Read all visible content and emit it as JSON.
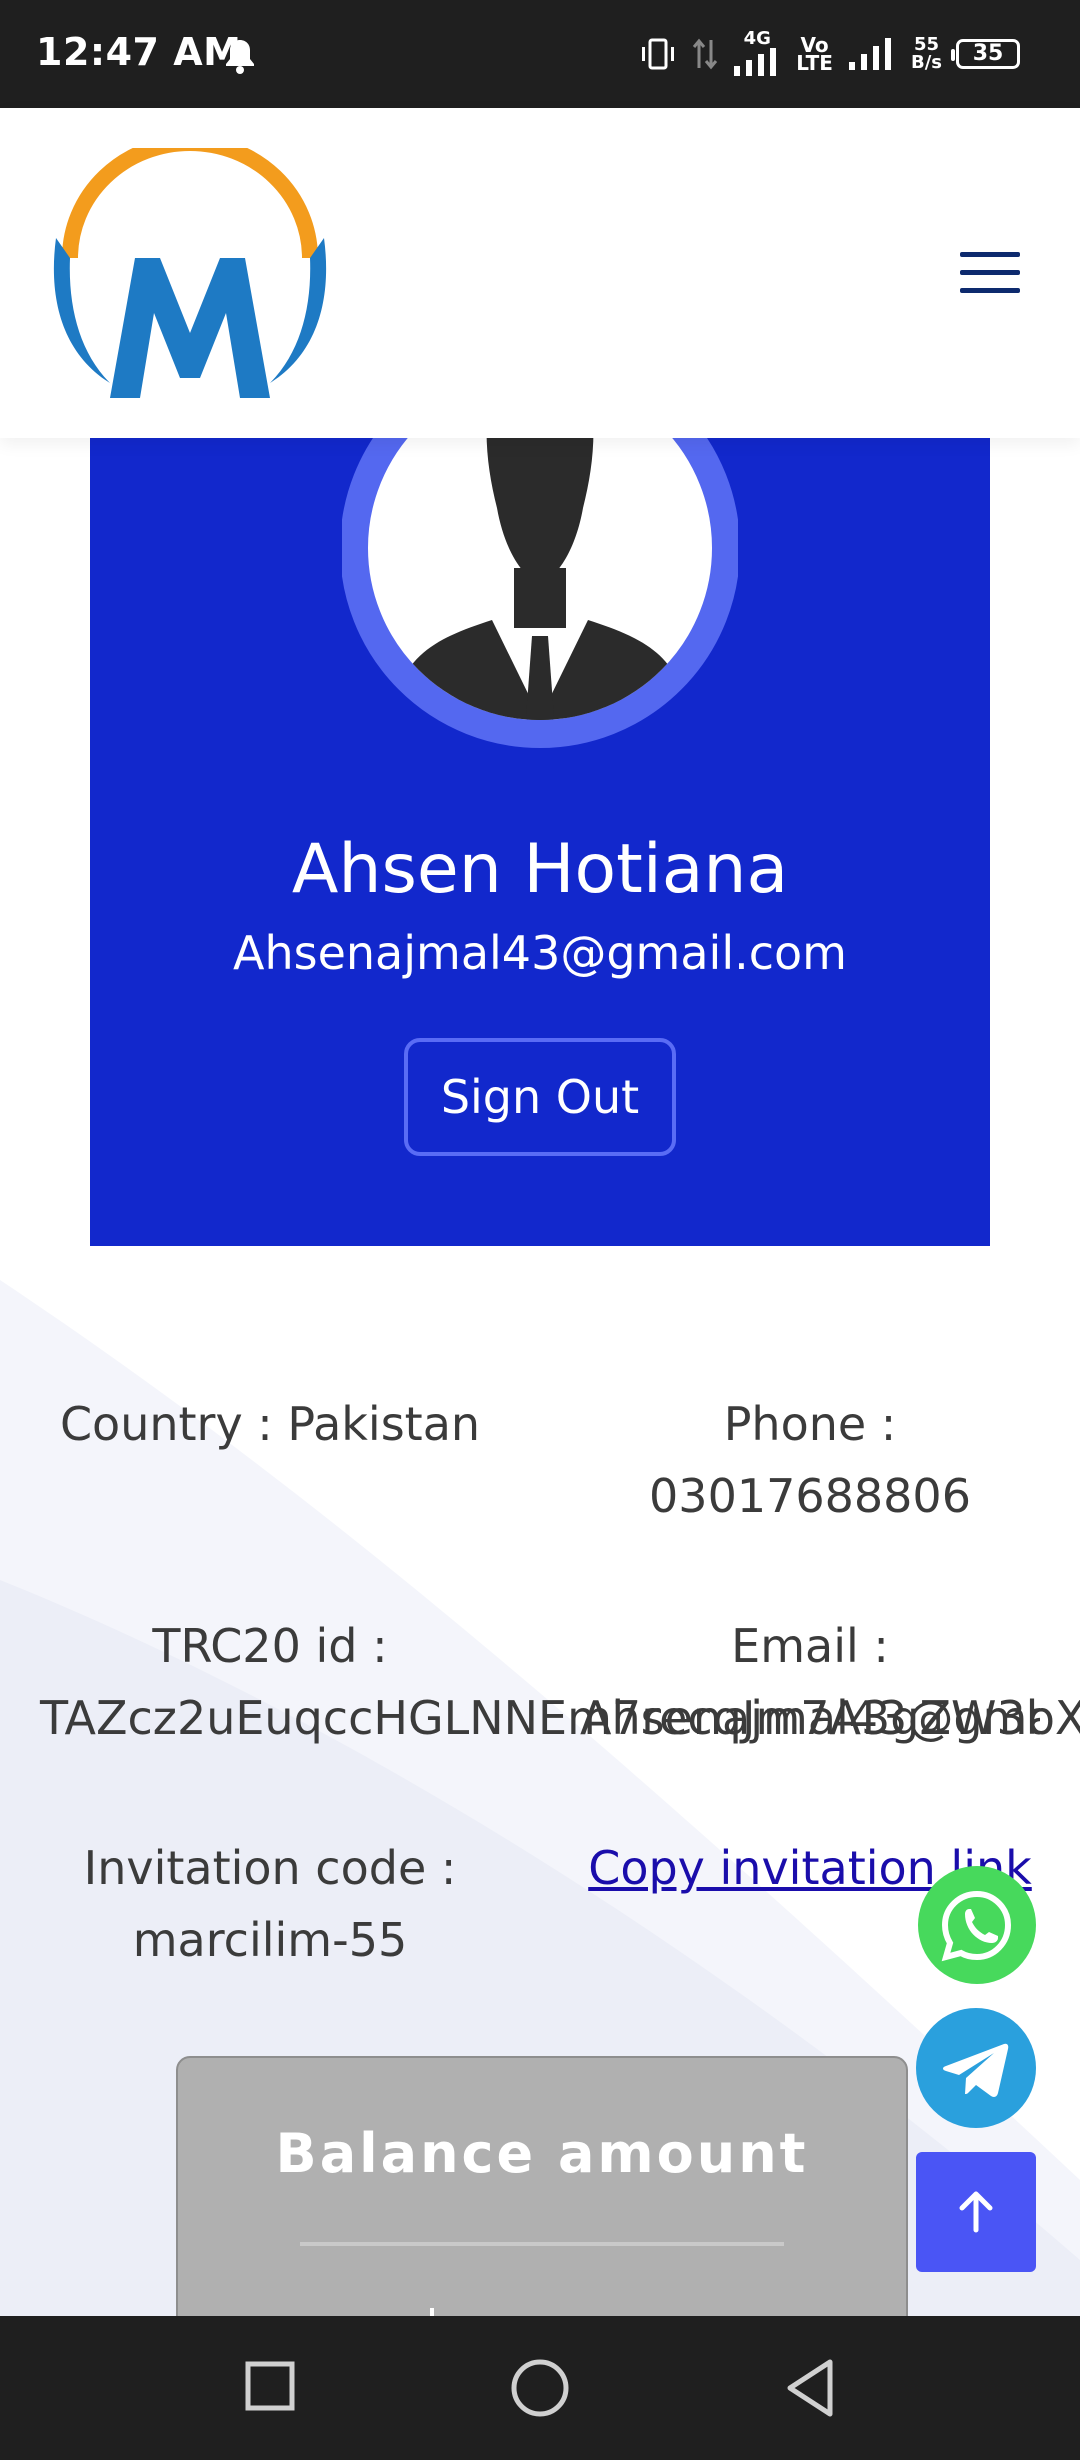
{
  "status_bar": {
    "time": "12:47 AM",
    "net_4g": "4G",
    "volte_top": "Vo",
    "volte_bottom": "LTE",
    "speed_top": "55",
    "speed_bottom": "B/s",
    "battery": "35"
  },
  "header": {
    "logo_letter": "M",
    "colors": {
      "logo_blue": "#1e7ac4",
      "logo_orange": "#f39c1d",
      "hamburger": "#0d2a6e"
    }
  },
  "profile": {
    "name": "Ahsen Hotiana",
    "email": "Ahsenajmal43@gmail.com",
    "signout_label": "Sign Out",
    "card_color": "#1228cc"
  },
  "info": {
    "country_label": "Country : Pakistan",
    "phone_label": "Phone :",
    "phone_value": "03017688806",
    "trc20_label": "TRC20 id :",
    "trc20_value": "TAZcz2uEuqccHGLNNEm7recqJm7A3gZW3bX",
    "email_label": "Email :",
    "email_value": "Ahsenajmal43@gmail.com",
    "invitation_label": "Invitation code :",
    "invitation_value": "marcilim-55",
    "copy_link": "Copy invitation link"
  },
  "balance": {
    "title": "Balance amount"
  },
  "floating": {
    "whatsapp": "whatsapp-icon",
    "telegram": "telegram-icon",
    "scroll_top": "arrow-up-icon"
  },
  "nav": {
    "recent": "square-icon",
    "home": "circle-icon",
    "back": "triangle-back-icon"
  }
}
